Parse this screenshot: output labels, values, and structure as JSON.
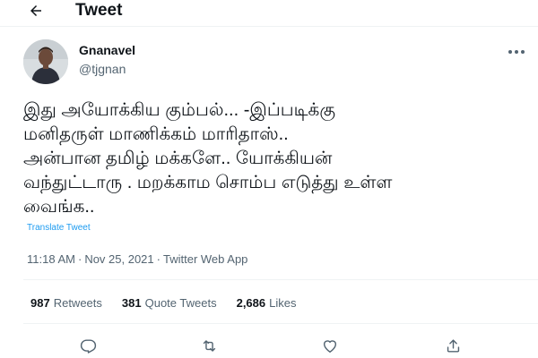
{
  "header": {
    "title": "Tweet"
  },
  "tweet": {
    "author_name": "Gnanavel",
    "author_handle": "@tjgnan",
    "text": "இது அயோக்கிய கும்பல்... -இப்படிக்கு\nமனிதருள் மாணிக்கம் மாரிதாஸ்..\nஅன்பான தமிழ் மக்களே.. யோக்கியன்\nவந்துட்டாரு . மறக்காம சொம்ப எடுத்து உள்ள\nவைங்க..",
    "translate_label": "Translate Tweet",
    "time": "11:18 AM",
    "date": "Nov 25, 2021",
    "separator": "·",
    "source": "Twitter Web App"
  },
  "stats": {
    "retweets_count": "987",
    "retweets_label": "Retweets",
    "quotes_count": "381",
    "quotes_label": "Quote Tweets",
    "likes_count": "2,686",
    "likes_label": "Likes"
  },
  "icons": {
    "back": "arrow-left-icon",
    "more": "more-horizontal-icon",
    "reply": "reply-icon",
    "retweet": "retweet-icon",
    "like": "heart-icon",
    "share": "share-icon"
  },
  "colors": {
    "text": "#0f1419",
    "secondary": "#536471",
    "link": "#1d9bf0",
    "divider": "#eff3f4"
  }
}
